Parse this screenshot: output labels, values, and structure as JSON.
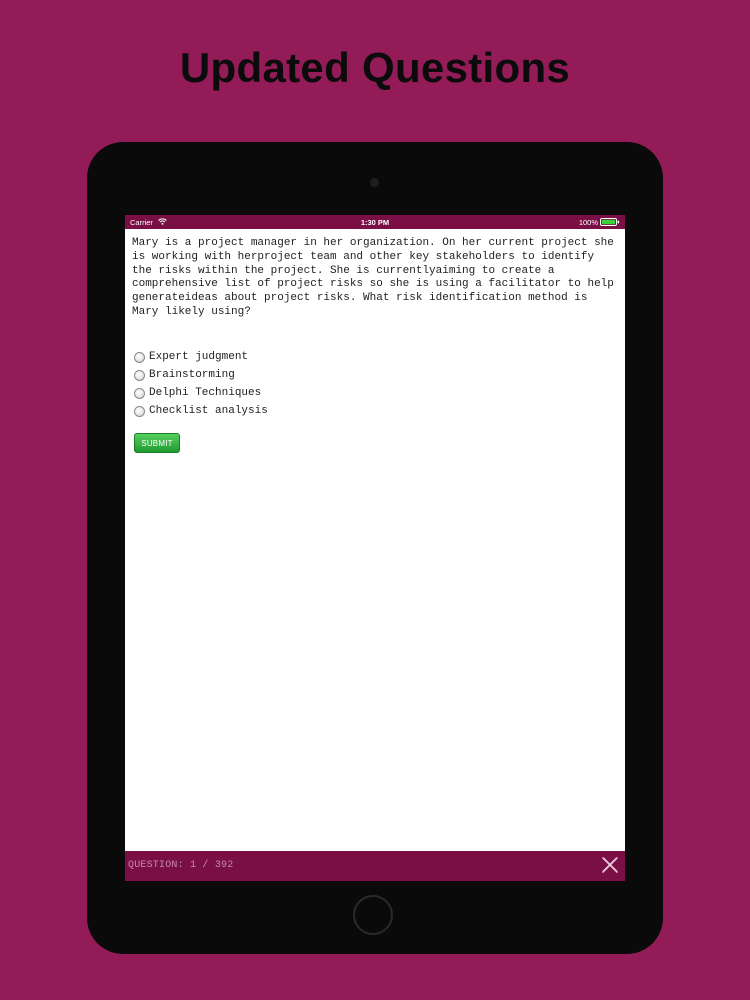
{
  "headline": "Updated Questions",
  "status_bar": {
    "carrier": "Carrier",
    "time": "1:30 PM",
    "battery": "100%",
    "wifi_icon": "wifi-icon",
    "battery_icon": "battery-full-icon"
  },
  "question": {
    "text": "Mary is a project manager in her organization. On her current project she is working with herproject team and other key stakeholders to identify the risks within the project. She is currentlyaiming to create a comprehensive list of project risks so she is using a facilitator to help generateideas about project risks. What risk identification method is Mary likely using?",
    "options": [
      {
        "label": "Expert judgment"
      },
      {
        "label": "Brainstorming"
      },
      {
        "label": "Delphi Techniques"
      },
      {
        "label": "Checklist analysis"
      }
    ],
    "submit_label": "SUBMIT"
  },
  "footer": {
    "counter": "QUESTION: 1 / 392",
    "close_icon": "close-icon"
  },
  "colors": {
    "background": "#931c58",
    "bar": "#7a0f45",
    "submit": "#2fb03c",
    "counter_text": "#c98aa8"
  }
}
